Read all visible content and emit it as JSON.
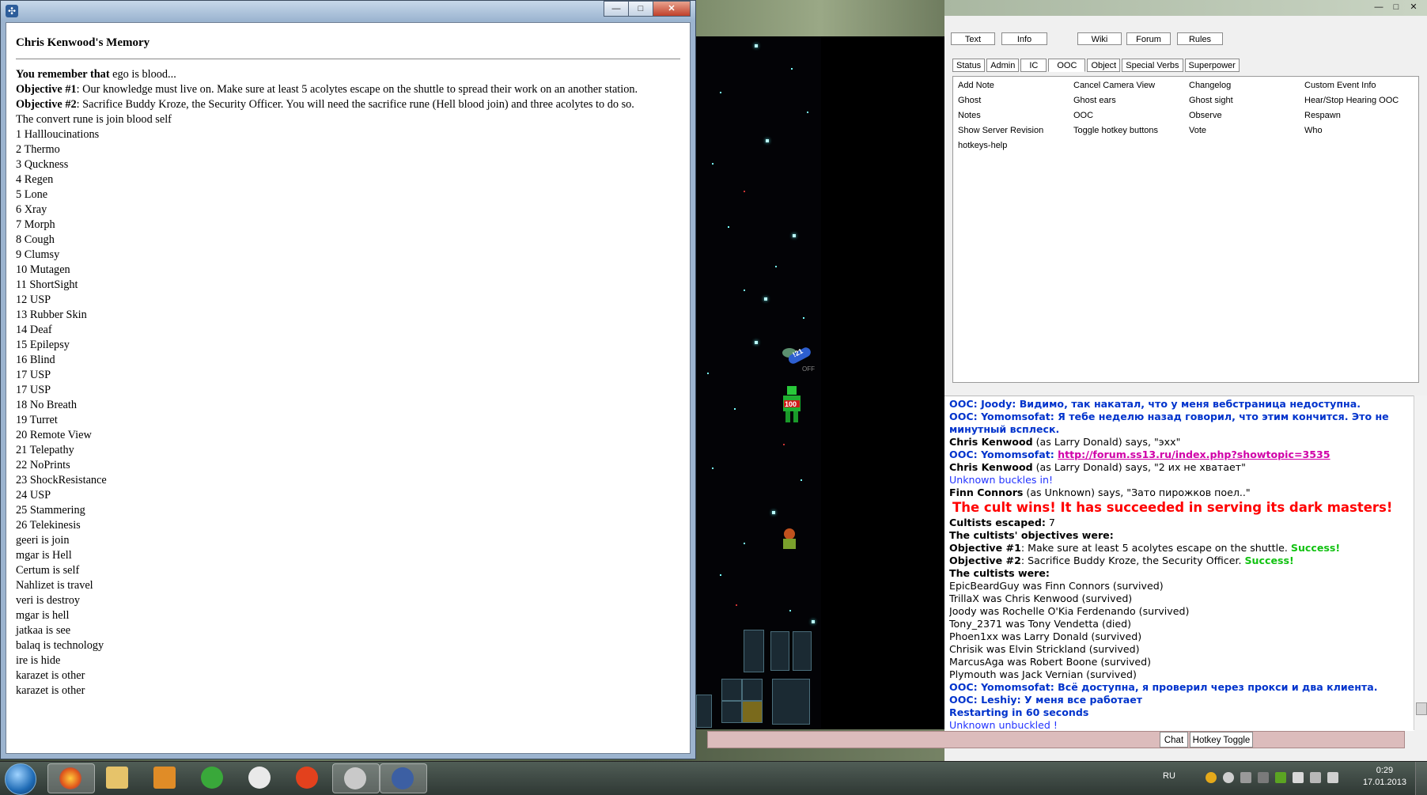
{
  "memory_window": {
    "title": "Chris Kenwood's Memory",
    "remember_label": "You remember that",
    "remember_text": " ego is blood...",
    "objective1_label": "Objective #1",
    "objective1_text": ": Our knowledge must live on. Make sure at least 5 acolytes escape on the shuttle to spread their work on an another station.",
    "objective2_label": "Objective #2",
    "objective2_text": ": Sacrifice Buddy Kroze, the Security Officer. You will need the sacrifice rune (Hell blood join) and three acolytes to do so.",
    "lines": [
      "The convert rune is join blood self",
      "1 Hallloucinations",
      "2 Thermo",
      "3 Quckness",
      "4 Regen",
      "5 Lone",
      "6 Xray",
      "7 Morph",
      "8 Cough",
      "9 Clumsy",
      "10 Mutagen",
      "11 ShortSight",
      "12 USP",
      "13 Rubber Skin",
      "14 Deaf",
      "15 Epilepsy",
      "16 Blind",
      "17 USP",
      "17 USP",
      "18 No Breath",
      "19 Turret",
      "20 Remote View",
      "21 Telepathy",
      "22 NoPrints",
      "23 ShockResistance",
      "24 USP",
      "25 Stammering",
      "26 Telekinesis",
      "geeri is join",
      "mgar is Hell",
      "Certum is self",
      "Nahlizet is travel",
      "veri is destroy",
      "mgar is hell",
      "jatkaa is see",
      "balaq is technology",
      "ire is hide",
      "karazet is other",
      "karazet is other"
    ],
    "buttons": {
      "minimize": "—",
      "maximize": "□",
      "close": "✕"
    }
  },
  "game": {
    "mob_labels": {
      "tank": "!21",
      "health": "100",
      "off": "OFF"
    }
  },
  "right_panel": {
    "window_buttons": {
      "minimize": "—",
      "maximize": "□",
      "close": "✕"
    },
    "top_buttons": [
      "Text",
      "Info",
      "Wiki",
      "Forum",
      "Rules"
    ],
    "tabs": [
      "Status",
      "Admin",
      "IC",
      "OOC",
      "Object",
      "Special Verbs",
      "Superpower"
    ],
    "active_tab": "OOC",
    "verbs": [
      "Add Note",
      "Cancel Camera View",
      "Changelog",
      "Custom Event Info",
      "Ghost",
      "Ghost ears",
      "Ghost sight",
      "Hear/Stop Hearing OOC",
      "Notes",
      "OOC",
      "Observe",
      "Respawn",
      "Show Server Revision",
      "Toggle hotkey buttons",
      "Vote",
      "Who",
      "hotkeys-help"
    ],
    "chat": {
      "ooc_joody": "OOC: Joody: Видимо, так накатал, что у меня вебстраница недоступна.",
      "ooc_yomo1a": "OOC: Yomomsofat: Я тебе неделю назад говорил, что этим кончится. Это не",
      "ooc_yomo1b": "минутный всплеск.",
      "ck1_name": "Chris Kenwood",
      "ck1_text": " (as Larry Donald) says, \"эхх\"",
      "ooc_yomo2": "OOC: Yomomsofat: ",
      "ooc_yomo2_link": "http://forum.ss13.ru/index.php?showtopic=3535",
      "ck2_name": "Chris Kenwood",
      "ck2_text": " (as Larry Donald) says, \"2 их не хватает\"",
      "unknown_buckles": "Unknown buckles in!",
      "finn_name": "Finn Connors",
      "finn_text": " (as Unknown) says, \"Зато пирожков поел..\"",
      "cult_wins": "The cult wins! It has succeeded in serving its dark masters!",
      "escaped_label": "Cultists escaped:",
      "escaped_value": " 7",
      "objectives_header": "The cultists' objectives were:",
      "obj1_label": "Objective #1",
      "obj1_text": ": Make sure at least 5 acolytes escape on the shuttle. ",
      "obj1_result": "Success!",
      "obj2_label": "Objective #2",
      "obj2_text": ": Sacrifice Buddy Kroze, the Security Officer. ",
      "obj2_result": "Success!",
      "cultists_header": "The cultists were:",
      "cultists": [
        "EpicBeardGuy was Finn Connors (survived)",
        "TrillaX was Chris Kenwood (survived)",
        "Joody was Rochelle O'Kia Ferdenando (survived)",
        "Tony_2371 was Tony Vendetta (died)",
        "Phoen1xx was Larry Donald (survived)",
        "Chrisik was Elvin Strickland (survived)",
        "MarcusAga was Robert Boone (survived)",
        "Plymouth was Jack Vernian (survived)"
      ],
      "ooc_yomo3": "OOC: Yomomsofat: Всё доступна, я проверил через прокси и два клиента.",
      "ooc_leshiy": "OOC: Leshiy: У меня все работает",
      "restarting": "Restarting in 60 seconds",
      "unknown_unbuckled": "Unknown unbuckled !"
    },
    "bottom_buttons": {
      "chat": "Chat",
      "hotkey": "Hotkey Toggle"
    }
  },
  "taskbar": {
    "language": "RU",
    "time": "0:29",
    "date": "17.01.2013",
    "apps": [
      "firefox-icon",
      "explorer-icon",
      "media-player-icon",
      "utorrent-icon",
      "steam-icon",
      "flash-icon",
      "speaker-app-icon",
      "byond-ss13-icon"
    ]
  }
}
